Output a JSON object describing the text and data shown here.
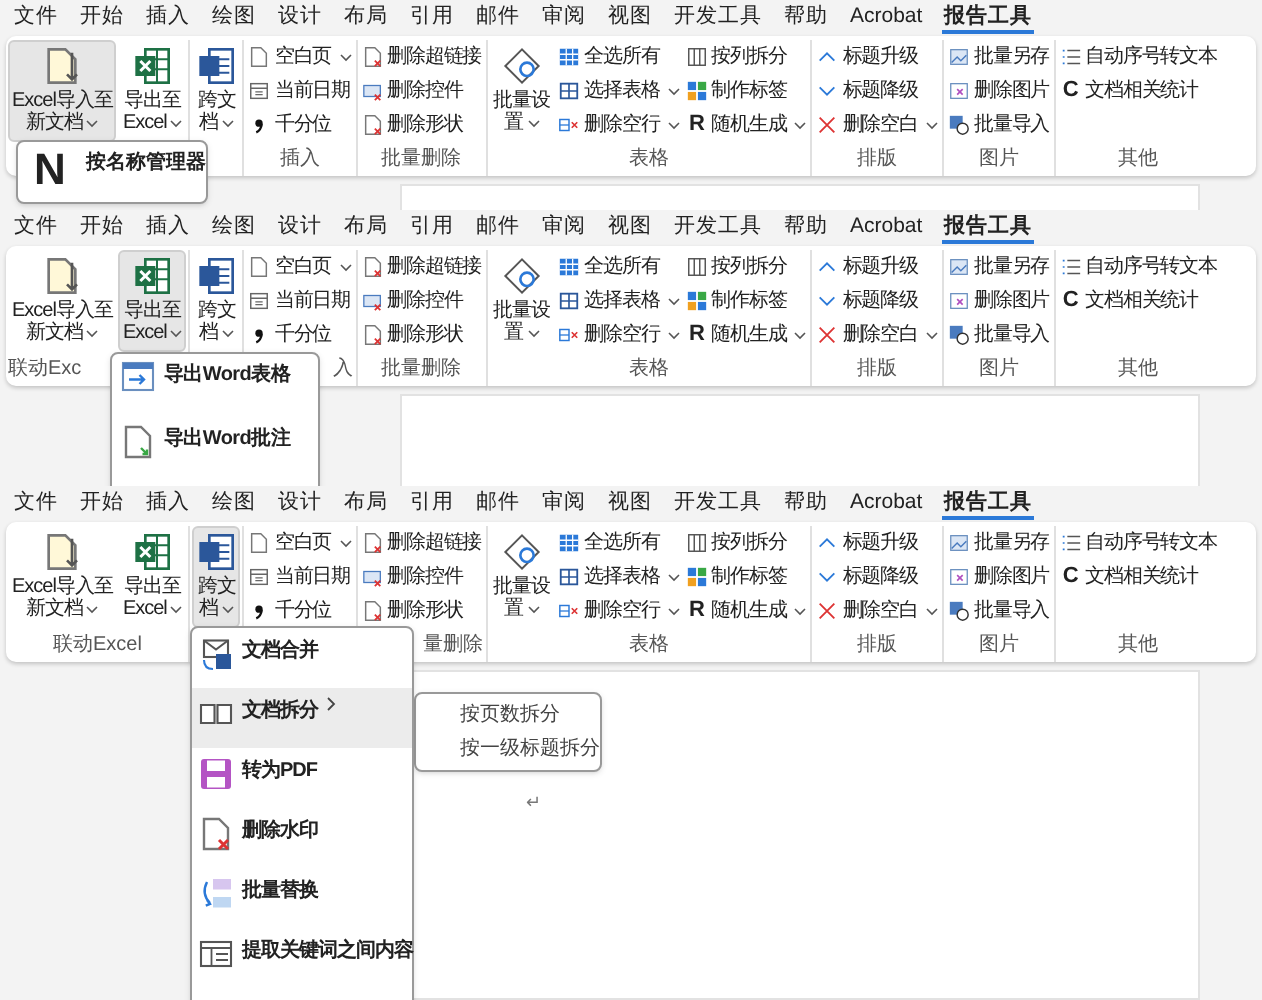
{
  "panels": [
    {
      "tabs": [
        {
          "label": "文件",
          "selected": false
        },
        {
          "label": "开始",
          "selected": false
        },
        {
          "label": "插入",
          "selected": false
        },
        {
          "label": "绘图",
          "selected": false
        },
        {
          "label": "设计",
          "selected": false
        },
        {
          "label": "布局",
          "selected": false
        },
        {
          "label": "引用",
          "selected": false
        },
        {
          "label": "邮件",
          "selected": false
        },
        {
          "label": "审阅",
          "selected": false
        },
        {
          "label": "视图",
          "selected": false
        },
        {
          "label": "开发工具",
          "selected": false
        },
        {
          "label": "帮助",
          "selected": false
        },
        {
          "label": "Acrobat",
          "selected": false
        },
        {
          "label": "报告工具",
          "selected": true
        }
      ],
      "groups": [
        {
          "items": [
            {
              "kind": "large",
              "lines": [
                "Excel导入至",
                "新文档"
              ],
              "caret": true,
              "highlighted": true
            },
            {
              "kind": "large",
              "lines": [
                "导出至",
                "Excel"
              ],
              "caret": true,
              "highlighted": false
            }
          ]
        },
        {
          "items": [
            {
              "kind": "large",
              "lines": [
                "跨文",
                "档"
              ],
              "caret": true,
              "highlighted": false
            }
          ]
        },
        {
          "label": "插入",
          "items": [
            {
              "kind": "small",
              "label": "空白页",
              "caret": true
            },
            {
              "kind": "small",
              "label": "当前日期",
              "caret": false
            },
            {
              "kind": "small",
              "label": "千分位",
              "caret": false
            }
          ]
        },
        {
          "label": "批量删除",
          "items": [
            {
              "kind": "small",
              "label": "删除超链接",
              "caret": false
            },
            {
              "kind": "small",
              "label": "删除控件",
              "caret": false
            },
            {
              "kind": "small",
              "label": "删除形状",
              "caret": false
            }
          ]
        },
        {
          "label": "表格",
          "items": [
            {
              "kind": "large",
              "lines": [
                "批量设",
                "置"
              ],
              "caret": true,
              "highlighted": false
            },
            {
              "kind": "small",
              "label": "全选所有",
              "caret": false
            },
            {
              "kind": "small",
              "label": "选择表格",
              "caret": true
            },
            {
              "kind": "small",
              "label": "删除空行",
              "caret": true
            },
            {
              "kind": "small",
              "label": "按列拆分",
              "caret": false
            },
            {
              "kind": "small",
              "label": "制作标签",
              "caret": false
            },
            {
              "kind": "small",
              "label": "随机生成",
              "caret": true,
              "glyph": "R"
            }
          ]
        },
        {
          "label": "排版",
          "items": [
            {
              "kind": "small",
              "label": "标题升级",
              "caret": false
            },
            {
              "kind": "small",
              "label": "标题降级",
              "caret": false
            },
            {
              "kind": "small",
              "label": "删除空白",
              "caret": true
            }
          ]
        },
        {
          "label": "图片",
          "items": [
            {
              "kind": "small",
              "label": "批量另存",
              "caret": false
            },
            {
              "kind": "small",
              "label": "删除图片",
              "caret": false
            },
            {
              "kind": "small",
              "label": "批量导入",
              "caret": false
            }
          ]
        },
        {
          "label": "其他",
          "items": [
            {
              "kind": "small",
              "label": "自动序号转文本",
              "caret": false
            },
            {
              "kind": "small",
              "label": "文档相关统计",
              "caret": false,
              "glyph": "C"
            }
          ]
        }
      ],
      "dropdown": {
        "items": [
          {
            "glyph": "N",
            "label": "按名称管理器"
          }
        ]
      }
    },
    {
      "tabs": [
        {
          "label": "文件",
          "selected": false
        },
        {
          "label": "开始",
          "selected": false
        },
        {
          "label": "插入",
          "selected": false
        },
        {
          "label": "绘图",
          "selected": false
        },
        {
          "label": "设计",
          "selected": false
        },
        {
          "label": "布局",
          "selected": false
        },
        {
          "label": "引用",
          "selected": false
        },
        {
          "label": "邮件",
          "selected": false
        },
        {
          "label": "审阅",
          "selected": false
        },
        {
          "label": "视图",
          "selected": false
        },
        {
          "label": "开发工具",
          "selected": false
        },
        {
          "label": "帮助",
          "selected": false
        },
        {
          "label": "Acrobat",
          "selected": false
        },
        {
          "label": "报告工具",
          "selected": true
        }
      ],
      "groups": [
        {
          "label": "联动Exc",
          "clipped_right": true,
          "items": [
            {
              "kind": "large",
              "lines": [
                "Excel导入至",
                "新文档"
              ],
              "caret": true,
              "highlighted": false
            },
            {
              "kind": "large",
              "lines": [
                "导出至",
                "Excel"
              ],
              "caret": true,
              "highlighted": true
            }
          ]
        },
        {
          "items": [
            {
              "kind": "large",
              "lines": [
                "跨文",
                "档"
              ],
              "caret": true,
              "highlighted": false
            }
          ]
        },
        {
          "label": "入",
          "clipped_left": true,
          "items": [
            {
              "kind": "small",
              "label": "空白页",
              "caret": true
            },
            {
              "kind": "small",
              "label": "当前日期",
              "caret": false
            },
            {
              "kind": "small",
              "label": "千分位",
              "caret": false
            }
          ]
        },
        {
          "label": "批量删除",
          "items": [
            {
              "kind": "small",
              "label": "删除超链接",
              "caret": false
            },
            {
              "kind": "small",
              "label": "删除控件",
              "caret": false
            },
            {
              "kind": "small",
              "label": "删除形状",
              "caret": false
            }
          ]
        },
        {
          "label": "表格",
          "items": [
            {
              "kind": "large",
              "lines": [
                "批量设",
                "置"
              ],
              "caret": true,
              "highlighted": false
            },
            {
              "kind": "small",
              "label": "全选所有",
              "caret": false
            },
            {
              "kind": "small",
              "label": "选择表格",
              "caret": true
            },
            {
              "kind": "small",
              "label": "删除空行",
              "caret": true
            },
            {
              "kind": "small",
              "label": "按列拆分",
              "caret": false
            },
            {
              "kind": "small",
              "label": "制作标签",
              "caret": false
            },
            {
              "kind": "small",
              "label": "随机生成",
              "caret": true,
              "glyph": "R"
            }
          ]
        },
        {
          "label": "排版",
          "items": [
            {
              "kind": "small",
              "label": "标题升级",
              "caret": false
            },
            {
              "kind": "small",
              "label": "标题降级",
              "caret": false
            },
            {
              "kind": "small",
              "label": "删除空白",
              "caret": true
            }
          ]
        },
        {
          "label": "图片",
          "items": [
            {
              "kind": "small",
              "label": "批量另存",
              "caret": false
            },
            {
              "kind": "small",
              "label": "删除图片",
              "caret": false
            },
            {
              "kind": "small",
              "label": "批量导入",
              "caret": false
            }
          ]
        },
        {
          "label": "其他",
          "items": [
            {
              "kind": "small",
              "label": "自动序号转文本",
              "caret": false
            },
            {
              "kind": "small",
              "label": "文档相关统计",
              "caret": false,
              "glyph": "C"
            }
          ]
        }
      ],
      "dropdown": {
        "items": [
          {
            "label": "导出Word表格"
          },
          {
            "label": "导出Word批注"
          }
        ]
      }
    },
    {
      "tabs": [
        {
          "label": "文件",
          "selected": false
        },
        {
          "label": "开始",
          "selected": false
        },
        {
          "label": "插入",
          "selected": false
        },
        {
          "label": "绘图",
          "selected": false
        },
        {
          "label": "设计",
          "selected": false
        },
        {
          "label": "布局",
          "selected": false
        },
        {
          "label": "引用",
          "selected": false
        },
        {
          "label": "邮件",
          "selected": false
        },
        {
          "label": "审阅",
          "selected": false
        },
        {
          "label": "视图",
          "selected": false
        },
        {
          "label": "开发工具",
          "selected": false
        },
        {
          "label": "帮助",
          "selected": false
        },
        {
          "label": "Acrobat",
          "selected": false
        },
        {
          "label": "报告工具",
          "selected": true
        }
      ],
      "groups": [
        {
          "label": "联动Excel",
          "items": [
            {
              "kind": "large",
              "lines": [
                "Excel导入至",
                "新文档"
              ],
              "caret": true,
              "highlighted": false
            },
            {
              "kind": "large",
              "lines": [
                "导出至",
                "Excel"
              ],
              "caret": true,
              "highlighted": false
            }
          ]
        },
        {
          "items": [
            {
              "kind": "large",
              "lines": [
                "跨文",
                "档"
              ],
              "caret": true,
              "highlighted": true
            }
          ]
        },
        {
          "items": [
            {
              "kind": "small",
              "label": "空白页",
              "caret": true
            },
            {
              "kind": "small",
              "label": "当前日期",
              "caret": false
            },
            {
              "kind": "small",
              "label": "千分位",
              "caret": false
            }
          ]
        },
        {
          "label": "量删除",
          "clipped_left": true,
          "items": [
            {
              "kind": "small",
              "label": "删除超链接",
              "caret": false
            },
            {
              "kind": "small",
              "label": "删除控件",
              "caret": false
            },
            {
              "kind": "small",
              "label": "删除形状",
              "caret": false
            }
          ]
        },
        {
          "label": "表格",
          "items": [
            {
              "kind": "large",
              "lines": [
                "批量设",
                "置"
              ],
              "caret": true,
              "highlighted": false
            },
            {
              "kind": "small",
              "label": "全选所有",
              "caret": false
            },
            {
              "kind": "small",
              "label": "选择表格",
              "caret": true
            },
            {
              "kind": "small",
              "label": "删除空行",
              "caret": true
            },
            {
              "kind": "small",
              "label": "按列拆分",
              "caret": false
            },
            {
              "kind": "small",
              "label": "制作标签",
              "caret": false
            },
            {
              "kind": "small",
              "label": "随机生成",
              "caret": true,
              "glyph": "R"
            }
          ]
        },
        {
          "label": "排版",
          "items": [
            {
              "kind": "small",
              "label": "标题升级",
              "caret": false
            },
            {
              "kind": "small",
              "label": "标题降级",
              "caret": false
            },
            {
              "kind": "small",
              "label": "删除空白",
              "caret": true
            }
          ]
        },
        {
          "label": "图片",
          "items": [
            {
              "kind": "small",
              "label": "批量另存",
              "caret": false
            },
            {
              "kind": "small",
              "label": "删除图片",
              "caret": false
            },
            {
              "kind": "small",
              "label": "批量导入",
              "caret": false
            }
          ]
        },
        {
          "label": "其他",
          "items": [
            {
              "kind": "small",
              "label": "自动序号转文本",
              "caret": false
            },
            {
              "kind": "small",
              "label": "文档相关统计",
              "caret": false,
              "glyph": "C"
            }
          ]
        }
      ],
      "dropdown": {
        "items": [
          {
            "label": "文档合并",
            "highlighted": false,
            "has_submenu": false
          },
          {
            "label": "文档拆分",
            "highlighted": true,
            "has_submenu": true,
            "submenu": [
              {
                "label": "按页数拆分"
              },
              {
                "label": "按一级标题拆分"
              }
            ]
          },
          {
            "label": "转为PDF",
            "highlighted": false,
            "has_submenu": false
          },
          {
            "label": "删除水印",
            "highlighted": false,
            "has_submenu": false
          },
          {
            "label": "批量替换",
            "highlighted": false,
            "has_submenu": false
          },
          {
            "label": "提取关键词之间内容",
            "highlighted": false,
            "has_submenu": false
          }
        ]
      },
      "document": {
        "paragraph_mark": "↵"
      }
    }
  ]
}
